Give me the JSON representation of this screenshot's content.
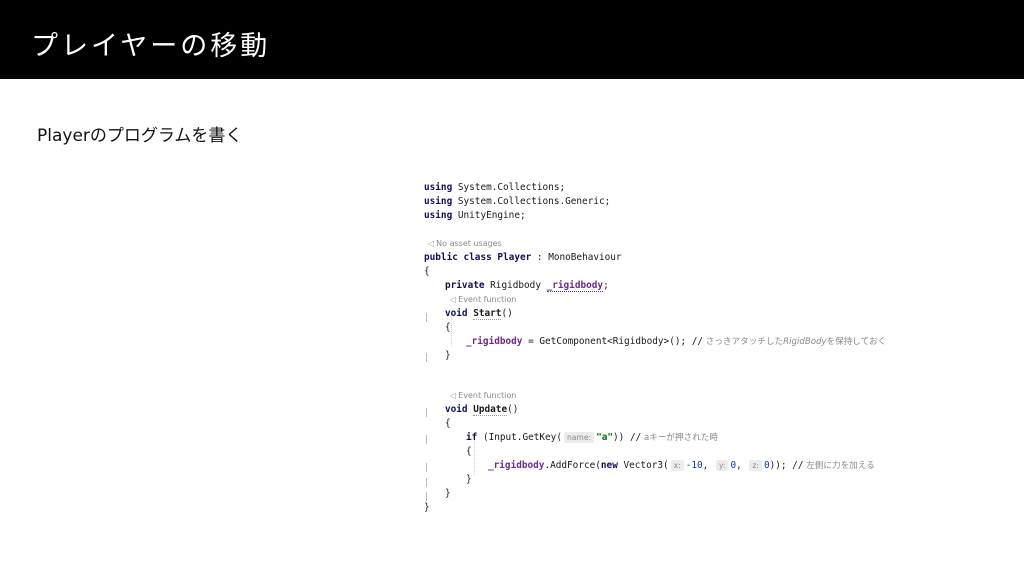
{
  "slide": {
    "title": "プレイヤーの移動",
    "subtitle": "Playerのプログラムを書く"
  },
  "code": {
    "using1": "using",
    "using1_ns": " System.Collections;",
    "using2": "using",
    "using2_ns": " System.Collections.Generic;",
    "using3": "using",
    "using3_ns": " UnityEngine;",
    "hint_usages": "No asset usages",
    "class_public": "public",
    "class_kw": " class ",
    "class_name": "Player",
    "class_base": " : MonoBehaviour",
    "open_brace": "{",
    "close_brace": "}",
    "field_private": "private",
    "field_type": " Rigidbody ",
    "field_name": "_rigidbody",
    "semicolon": ";",
    "hint_event": "Event function",
    "void_kw": "void",
    "start_name": "Start",
    "parens": "()",
    "getcomp_field": "_rigidbody",
    "getcomp_expr": " = GetComponent<Rigidbody>(); //",
    "getcomp_comment_a": " さっきアタッチした",
    "getcomp_comment_b": "RigidBody",
    "getcomp_comment_c": "を保持しておく",
    "update_name": "Update",
    "if_kw": "if",
    "if_expr_a": " (Input.GetKey(",
    "param_name": "name:",
    "key_string": "\"a\"",
    "if_expr_b": ")) //",
    "if_comment": " aキーが押された時",
    "addforce_field": "_rigidbody",
    "addforce_a": ".AddForce(",
    "new_kw": "new",
    "addforce_b": " Vector3(",
    "param_x": "x:",
    "val_x": "-10",
    "param_y": "y:",
    "val_y": "0",
    "param_z": "z:",
    "val_z": "0",
    "comma": ", ",
    "addforce_end": ")); //",
    "addforce_comment": " 左側に力を加える"
  },
  "icons": {
    "usage_hint": "usage-hint-icon",
    "event_hint": "event-function-icon"
  },
  "colors": {
    "title_bar": "#000000",
    "keyword": "#101055",
    "field": "#6b2a8c",
    "string": "#0a6b12",
    "number": "#0a3aa8",
    "comment": "#8a8a8a"
  }
}
